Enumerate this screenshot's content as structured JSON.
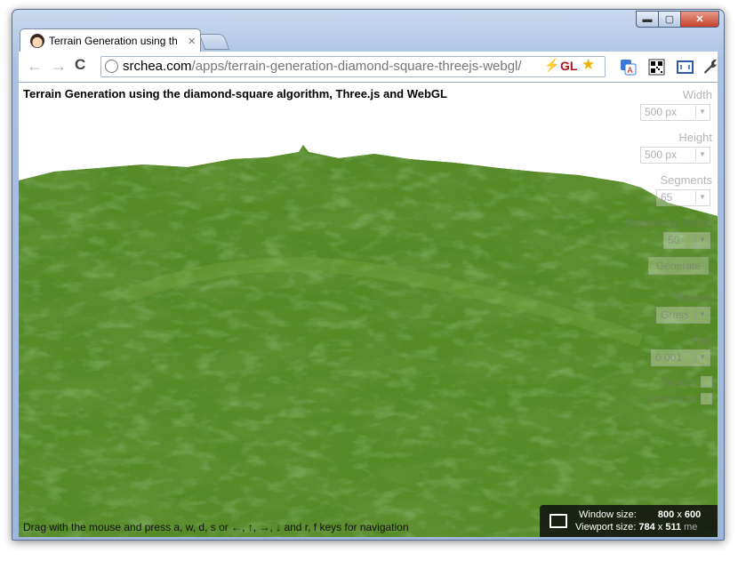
{
  "window": {
    "controls": {
      "minimize": "▬",
      "maximize": "▢",
      "close": "✕"
    }
  },
  "tab": {
    "title": "Terrain Generation using th",
    "close": "✕"
  },
  "toolbar": {
    "back_icon": "←",
    "forward_icon": "→",
    "reload_icon": "C",
    "url_domain": "srchea.com",
    "url_path": "/apps/terrain-generation-diamond-square-threejs-webgl/",
    "flash_icon": "⚡",
    "gl_badge": "GL",
    "star_icon": "★",
    "wrench_icon": "wrench-icon"
  },
  "page": {
    "title": "Terrain Generation using the diamond-square algorithm, Three.js and WebGL",
    "help_text": "Drag with the mouse and press a, w, d, s or ←, ↑, →, ↓ and r, f keys for navigation"
  },
  "panel": {
    "width_label": "Width",
    "width_value": "500 px",
    "height_label": "Height",
    "height_value": "500 px",
    "segments_label": "Segments",
    "segments_value": "65",
    "smoothing_label": "Smoothing factor",
    "smoothing_value": "50",
    "generate_label": "Generate",
    "texture_label": "Texture",
    "texture_value": "Grass",
    "fog_label": "Fog",
    "fog_value": "0.001",
    "border_label": "Border",
    "showinfo_label": "Show info"
  },
  "sizebox": {
    "window_label": "Window size:",
    "window_w": "800",
    "window_x": "x",
    "window_h": "600",
    "viewport_label": "Viewport size:",
    "viewport_w": "784",
    "viewport_x": "x",
    "viewport_h": "511",
    "trailing": "me"
  },
  "colors": {
    "grass_dark": "#4f8a22",
    "grass_light": "#8fb34a",
    "soil": "#b39b63"
  }
}
